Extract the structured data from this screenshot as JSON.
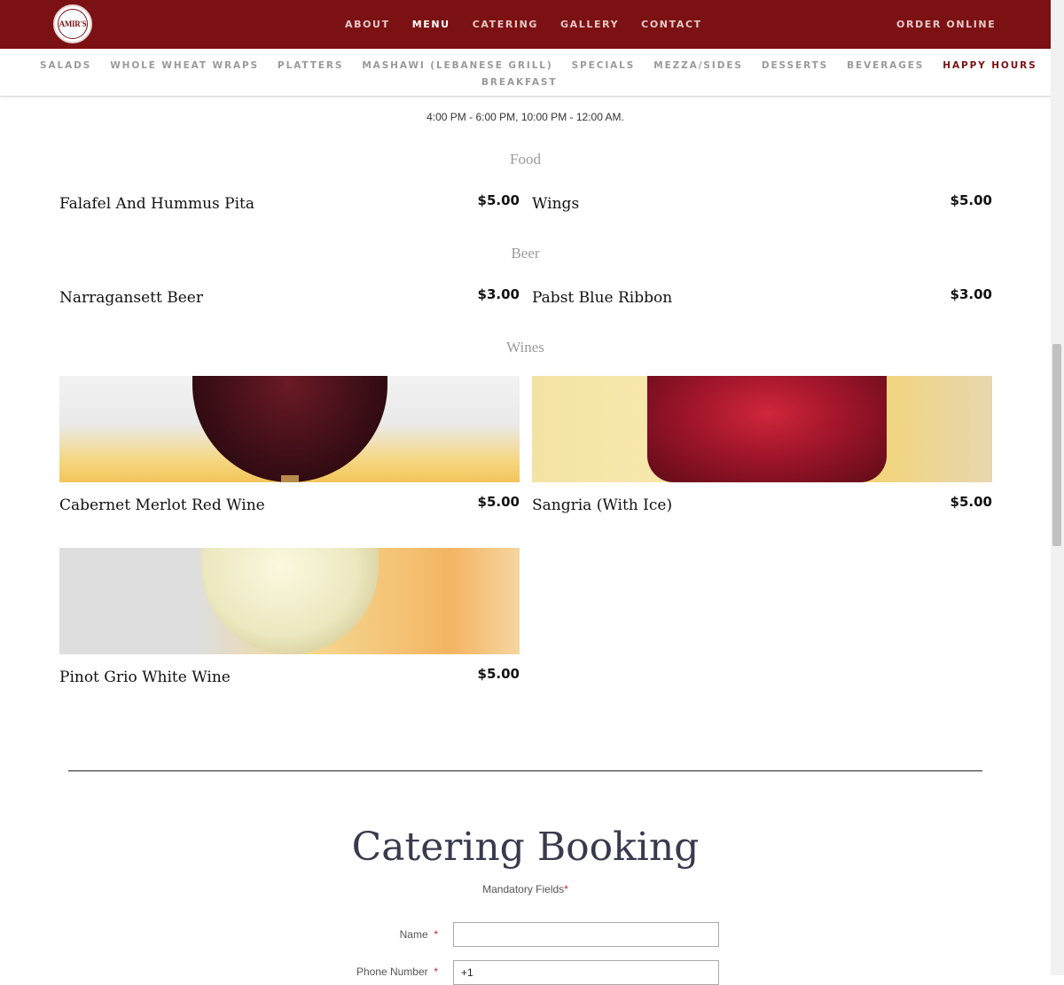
{
  "brand": {
    "logo_text": "AMIR'S"
  },
  "topnav": {
    "items": [
      "ABOUT",
      "MENU",
      "CATERING",
      "GALLERY",
      "CONTACT"
    ],
    "active": "MENU",
    "order_online": "ORDER ONLINE"
  },
  "subnav": {
    "items": [
      "SALADS",
      "WHOLE WHEAT WRAPS",
      "PLATTERS",
      "MASHAWI (LEBANESE GRILL)",
      "SPECIALS",
      "MEZZA/SIDES",
      "DESSERTS",
      "BEVERAGES",
      "HAPPY HOURS"
    ],
    "second_row": "BREAKFAST",
    "active": "HAPPY HOURS"
  },
  "hours": "4:00 PM - 6:00 PM, 10:00 PM - 12:00 AM.",
  "sections": {
    "food": {
      "title": "Food",
      "items": [
        {
          "name": "Falafel And Hummus Pita",
          "price": "$5.00"
        },
        {
          "name": "Wings",
          "price": "$5.00"
        }
      ]
    },
    "beer": {
      "title": "Beer",
      "items": [
        {
          "name": "Narragansett Beer",
          "price": "$3.00"
        },
        {
          "name": "Pabst Blue Ribbon",
          "price": "$3.00"
        }
      ]
    },
    "wines": {
      "title": "Wines",
      "items": [
        {
          "name": "Cabernet Merlot Red Wine",
          "price": "$5.00"
        },
        {
          "name": "Sangria (With Ice)",
          "price": "$5.00"
        },
        {
          "name": "Pinot Grio White Wine",
          "price": "$5.00"
        }
      ]
    }
  },
  "booking": {
    "title": "Catering Booking",
    "mandatory_label": "Mandatory Fields",
    "required_mark": "*",
    "fields": [
      {
        "label": "Name",
        "value": ""
      },
      {
        "label": "Phone Number",
        "value": "+1"
      }
    ]
  },
  "colors": {
    "brand": "#7b1113",
    "required": "#c1272d"
  }
}
